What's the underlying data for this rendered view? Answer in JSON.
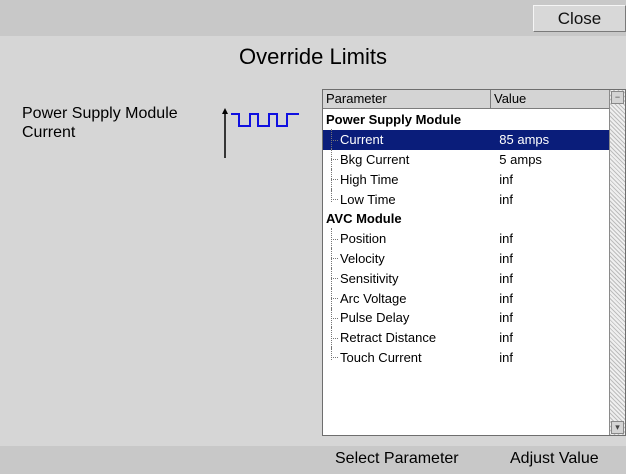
{
  "toolbar": {
    "close_label": "Close"
  },
  "page": {
    "title": "Override Limits"
  },
  "left_label": {
    "line1": "Power Supply Module",
    "line2": "Current"
  },
  "table": {
    "col_parameter": "Parameter",
    "col_value": "Value",
    "groups": [
      {
        "name": "Power Supply Module",
        "rows": [
          {
            "param": "Current",
            "value": "85 amps",
            "selected": true
          },
          {
            "param": "Bkg Current",
            "value": "5 amps"
          },
          {
            "param": "High Time",
            "value": "inf"
          },
          {
            "param": "Low Time",
            "value": "inf"
          }
        ]
      },
      {
        "name": "AVC Module",
        "rows": [
          {
            "param": "Position",
            "value": "inf"
          },
          {
            "param": "Velocity",
            "value": "inf"
          },
          {
            "param": "Sensitivity",
            "value": "inf"
          },
          {
            "param": "Arc Voltage",
            "value": "inf"
          },
          {
            "param": "Pulse Delay",
            "value": "inf"
          },
          {
            "param": "Retract Distance",
            "value": "inf"
          },
          {
            "param": "Touch Current",
            "value": "inf"
          }
        ]
      }
    ]
  },
  "footer": {
    "select_label": "Select Parameter",
    "adjust_label": "Adjust Value"
  },
  "colors": {
    "selection": "#0a1d7a",
    "waveform": "#1010e0"
  },
  "icons": {
    "waveform": "pulse-waveform-icon"
  }
}
